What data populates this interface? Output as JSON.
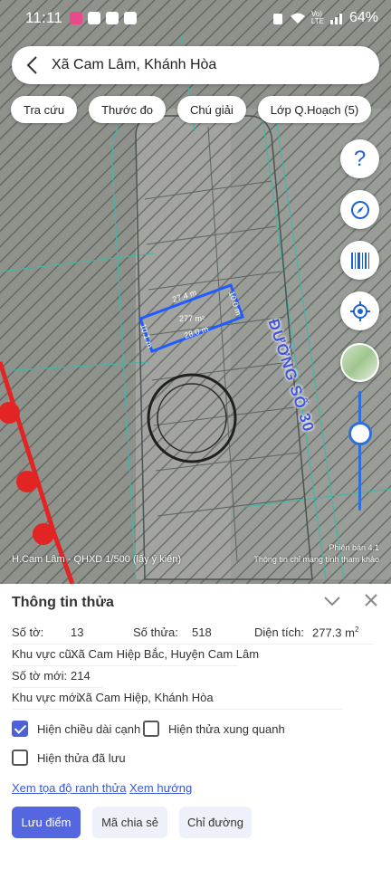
{
  "status_bar": {
    "time": "11:11",
    "battery": "64%"
  },
  "search": {
    "title": "Xã Cam Lâm, Khánh Hòa"
  },
  "chips": [
    "Tra cứu",
    "Thước đo",
    "Chú giải",
    "Lớp Q.Hoạch (5)"
  ],
  "map": {
    "parcel_labels": {
      "top": "27.4 m",
      "right": "10.0 m",
      "bottom": "28.0 m",
      "left": "10.1 m",
      "area": "277 m²"
    },
    "street_label": "ĐƯỜNG SỐ 30",
    "caption": "H.Cam Lâm - QHXD 1/500 (lấy ý kiến)",
    "version": "Phiên bản 4.1",
    "disclaimer": "Thông tin chỉ mang tính tham khảo"
  },
  "sheet": {
    "title": "Thông tin thửa",
    "so_to_label": "Số tờ:",
    "so_to": "13",
    "so_thua_label": "Số thửa:",
    "so_thua": "518",
    "dien_tich_label": "Diện tích:",
    "dien_tich": "277.3 m",
    "kv_cu_label": "Khu vực cũ:",
    "kv_cu": "Xã Cam Hiệp Bắc, Huyện Cam Lâm",
    "so_to_moi_label": "Số tờ mới:",
    "so_to_moi": "214",
    "kv_moi_label": "Khu vực mới:",
    "kv_moi": "Xã Cam Hiệp, Khánh Hòa",
    "check1": "Hiện chiều dài cạnh",
    "check2": "Hiện thửa xung quanh",
    "check3": "Hiện thửa đã lưu",
    "link1": "Xem tọa độ ranh thửa",
    "link2": "Xem hướng",
    "btn_save": "Lưu điểm",
    "btn_share": "Mã chia sẻ",
    "btn_route": "Chỉ đường"
  }
}
